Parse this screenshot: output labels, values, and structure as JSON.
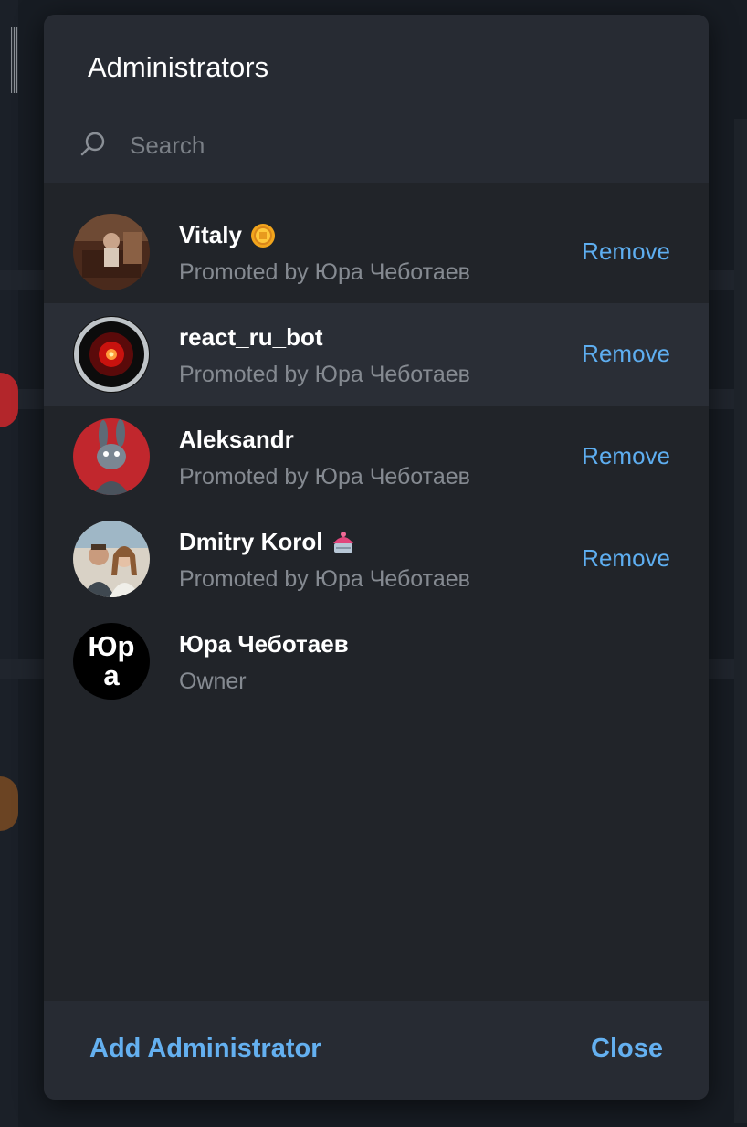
{
  "dialog": {
    "title": "Administrators",
    "search_placeholder": "Search"
  },
  "admins": [
    {
      "name": "Vitaly",
      "subtitle": "Promoted by Юра Чеботаев",
      "action": "Remove",
      "badge_icon": "coin-status-icon"
    },
    {
      "name": "react_ru_bot",
      "subtitle": "Promoted by Юра Чеботаев",
      "action": "Remove"
    },
    {
      "name": "Aleksandr",
      "subtitle": "Promoted by Юра Чеботаев",
      "action": "Remove"
    },
    {
      "name": "Dmitry Korol",
      "subtitle": "Promoted by Юра Чеботаев",
      "action": "Remove",
      "badge_icon": "cake-status-icon"
    },
    {
      "name": "Юра Чеботаев",
      "subtitle": "Owner",
      "avatar_text": "Юра"
    }
  ],
  "footer": {
    "add_label": "Add Administrator",
    "close_label": "Close"
  },
  "colors": {
    "accent": "#5eaef0",
    "modal_bg": "#212429",
    "header_bg": "#272b33",
    "subtitle": "#858a91"
  }
}
